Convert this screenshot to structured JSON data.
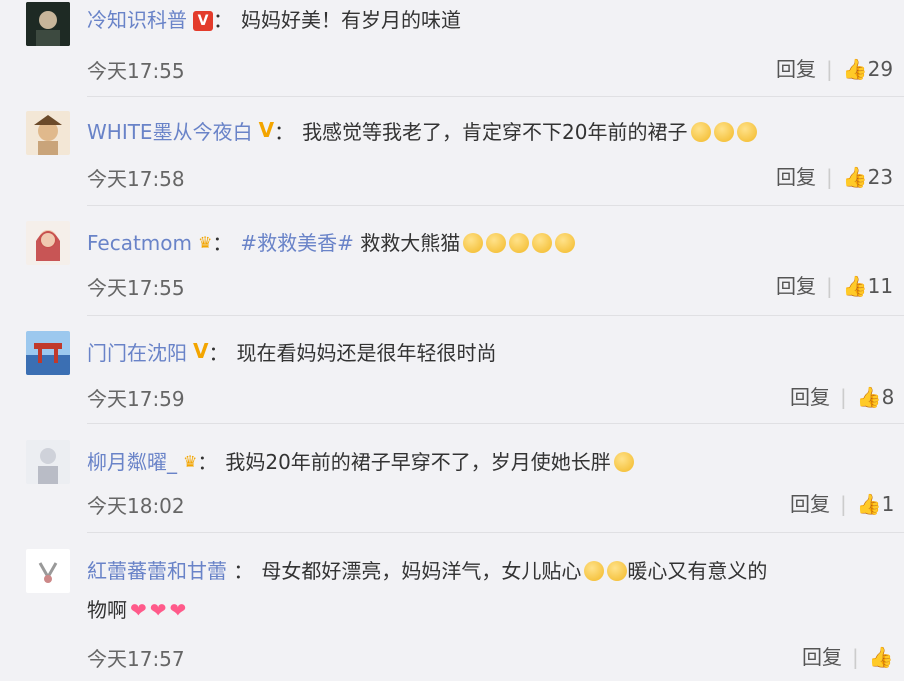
{
  "comments": [
    {
      "username": "冷知识科普",
      "badge": "V",
      "text": "妈妈好美！有岁月的味道",
      "time": "今天17:55",
      "reply": "回复",
      "likes": "29",
      "avatar_color": "#2b3b2b"
    },
    {
      "username": "WHITE墨从今夜白",
      "badge": "V",
      "text": "我感觉等我老了，肯定穿不下20年前的裙子",
      "time": "今天17:58",
      "reply": "回复",
      "likes": "23",
      "avatar_color": "#c9a47a"
    },
    {
      "username": "Fecatmom",
      "badge": "crown",
      "topic": "#救救美香#",
      "text": "救救大熊猫",
      "time": "今天17:55",
      "reply": "回复",
      "likes": "11",
      "avatar_color": "#c0393b"
    },
    {
      "username": "门门在沈阳",
      "badge": "V",
      "text": "现在看妈妈还是很年轻很时尚",
      "time": "今天17:59",
      "reply": "回复",
      "likes": "8",
      "avatar_color": "#3b6fb3"
    },
    {
      "username": "柳月粼曜_",
      "badge": "crown",
      "text": "我妈20年前的裙子早穿不了，岁月使她长胖",
      "time": "今天18:02",
      "reply": "回复",
      "likes": "1",
      "avatar_color": "#d8d8e0"
    },
    {
      "username": "紅蕾蕃蕾和甘蕾",
      "text": "母女都好漂亮，妈妈洋气，女儿贴心",
      "text_after": "暖心又有意义的",
      "text_line2": "物啊",
      "time": "今天17:57",
      "reply": "回复",
      "avatar_color": "#f0f0f0"
    }
  ],
  "colors": {
    "username": "#6983c8",
    "background": "#f2f2f5",
    "badge_red": "#e33b2b",
    "badge_yellow": "#f3a500"
  }
}
